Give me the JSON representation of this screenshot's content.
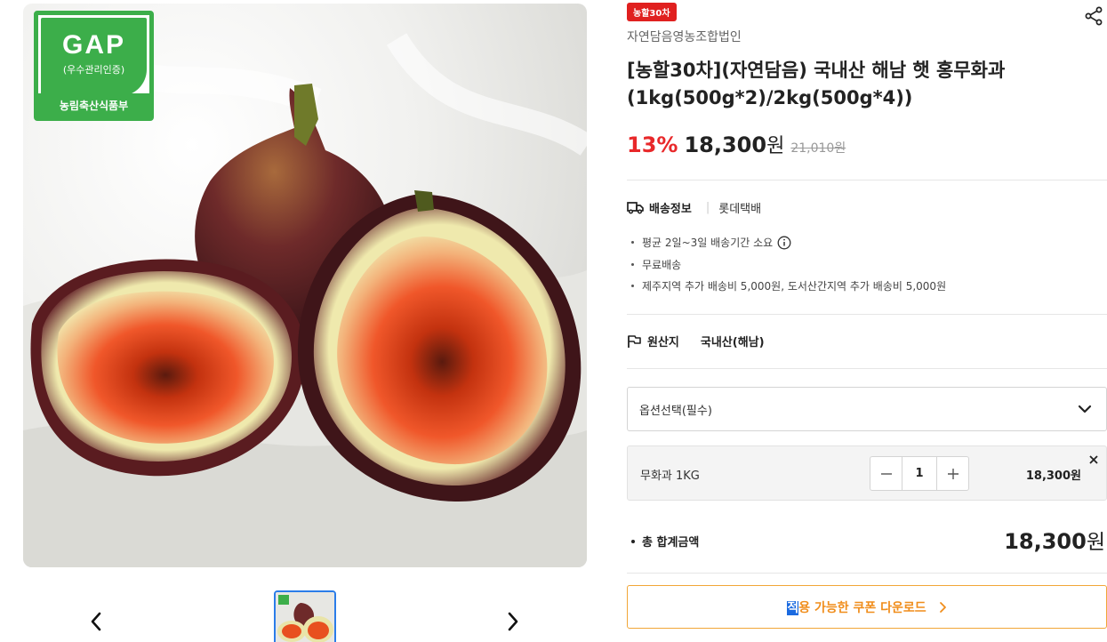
{
  "gallery": {
    "gap_title": "GAP",
    "gap_subtitle": "(우수관리인증)",
    "gap_ministry": "농림축산식품부",
    "prev_icon": "chevron-left-icon",
    "next_icon": "chevron-right-icon"
  },
  "product": {
    "promo_badge": "농할30차",
    "seller": "자연담음영농조합법인",
    "title": "[농할30차](자연담음) 국내산 해남 햇 홍무화과 (1kg(500g*2)/2kg(500g*4))",
    "discount": "13%",
    "price": "18,300",
    "price_unit": "원",
    "original_price": "21,010원"
  },
  "shipping": {
    "label": "배송정보",
    "company": "롯데택배",
    "lines": [
      "평균 2일~3일 배송기간 소요",
      "무료배송",
      "제주지역 추가 배송비 5,000원, 도서산간지역 추가 배송비 5,000원"
    ]
  },
  "origin": {
    "label": "원산지",
    "value": "국내산(해남)"
  },
  "option": {
    "placeholder": "옵션선택(필수)"
  },
  "selected_item": {
    "name": "무화과 1KG",
    "quantity": "1",
    "price": "18,300원"
  },
  "total": {
    "label": "총 합계금액",
    "amount": "18,300",
    "unit": "원"
  },
  "coupon": {
    "highlight": "적",
    "rest": "용 가능한 쿠폰 다운로드"
  },
  "colors": {
    "discount": "#e8282a",
    "badge": "#e0201f",
    "coupon_border": "#f1a637",
    "coupon_text": "#f08d1b",
    "gap_green": "#3cae4a",
    "thumb_border": "#2b7de9"
  }
}
